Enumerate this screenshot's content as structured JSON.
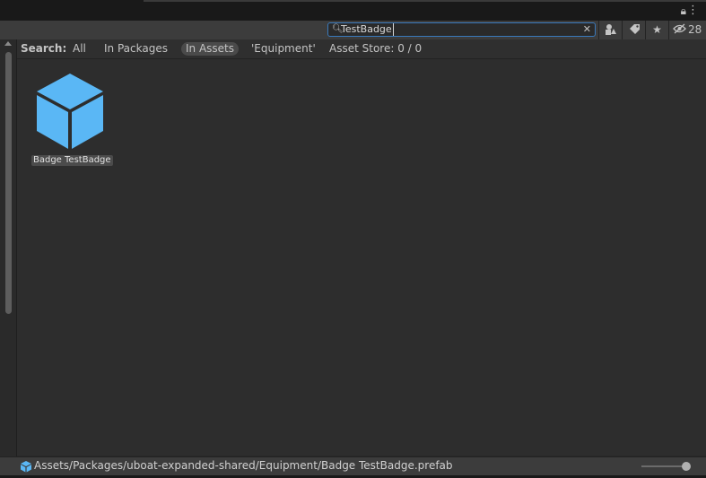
{
  "toolbar": {
    "search_value": "TestBadge",
    "hidden_count": "28"
  },
  "filter": {
    "label": "Search:",
    "all": "All",
    "in_packages": "In Packages",
    "in_assets": "In Assets",
    "folder": "'Equipment'",
    "asset_store": "Asset Store: 0 / 0"
  },
  "assets": [
    {
      "name": "Badge TestBadge",
      "icon": "prefab-cube-icon",
      "color": "#5ab7f5"
    }
  ],
  "status": {
    "path": "Assets/Packages/uboat-expanded-shared/Equipment/Badge TestBadge.prefab"
  },
  "icons": {
    "lock": "lock-icon",
    "menu": "kebab-menu-icon",
    "search": "search-icon",
    "clear": "clear-icon",
    "filter_type": "filter-by-type-icon",
    "filter_label": "filter-by-label-icon",
    "favorite": "star-icon",
    "hidden_packages": "eye-slash-icon"
  }
}
